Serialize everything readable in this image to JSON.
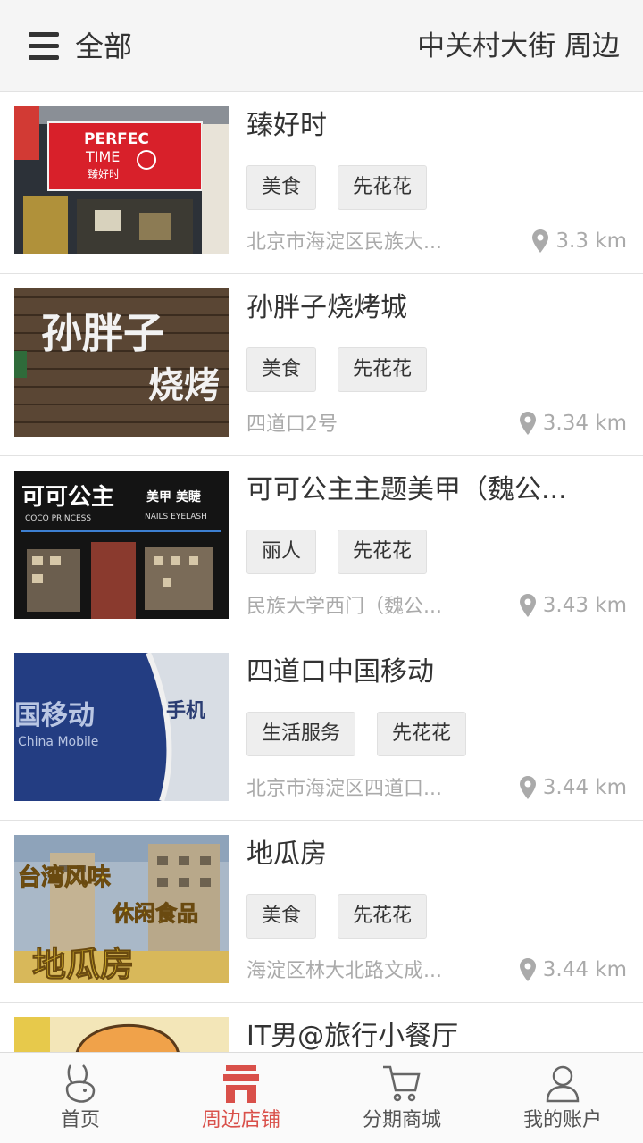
{
  "header": {
    "title": "全部",
    "location": "中关村大街 周边"
  },
  "stores": [
    {
      "name": "臻好时",
      "tags": [
        "美食",
        "先花花"
      ],
      "address": "北京市海淀区民族大...",
      "distance": "3.3 km",
      "sign_text": [
        "PERFEC",
        "TIME",
        "臻好时"
      ]
    },
    {
      "name": "孙胖子烧烤城",
      "tags": [
        "美食",
        "先花花"
      ],
      "address": "四道口2号",
      "distance": "3.34 km",
      "sign_text": [
        "孙胖子",
        "烧烤"
      ]
    },
    {
      "name": "可可公主主题美甲（魏公...",
      "tags": [
        "丽人",
        "先花花"
      ],
      "address": "民族大学西门（魏公...",
      "distance": "3.43 km",
      "sign_text": [
        "可可公主",
        "美甲 美睫",
        "COCO PRINCESS",
        "NAILS EYELASH"
      ]
    },
    {
      "name": "四道口中国移动",
      "tags": [
        "生活服务",
        "先花花"
      ],
      "address": "北京市海淀区四道口...",
      "distance": "3.44 km",
      "sign_text": [
        "国移动",
        "China Mobile",
        "手机"
      ]
    },
    {
      "name": "地瓜房",
      "tags": [
        "美食",
        "先花花"
      ],
      "address": "海淀区林大北路文成...",
      "distance": "3.44 km",
      "sign_text": [
        "台湾风味",
        "休闲食品",
        "地瓜房"
      ]
    },
    {
      "name": "IT男@旅行小餐厅",
      "tags": [],
      "address": "",
      "distance": ""
    }
  ],
  "tabbar": {
    "active_color": "#d9504a",
    "items": [
      {
        "label": "首页",
        "icon": "rabbit-icon"
      },
      {
        "label": "周边店铺",
        "icon": "store-icon"
      },
      {
        "label": "分期商城",
        "icon": "cart-icon"
      },
      {
        "label": "我的账户",
        "icon": "user-icon"
      }
    ]
  }
}
